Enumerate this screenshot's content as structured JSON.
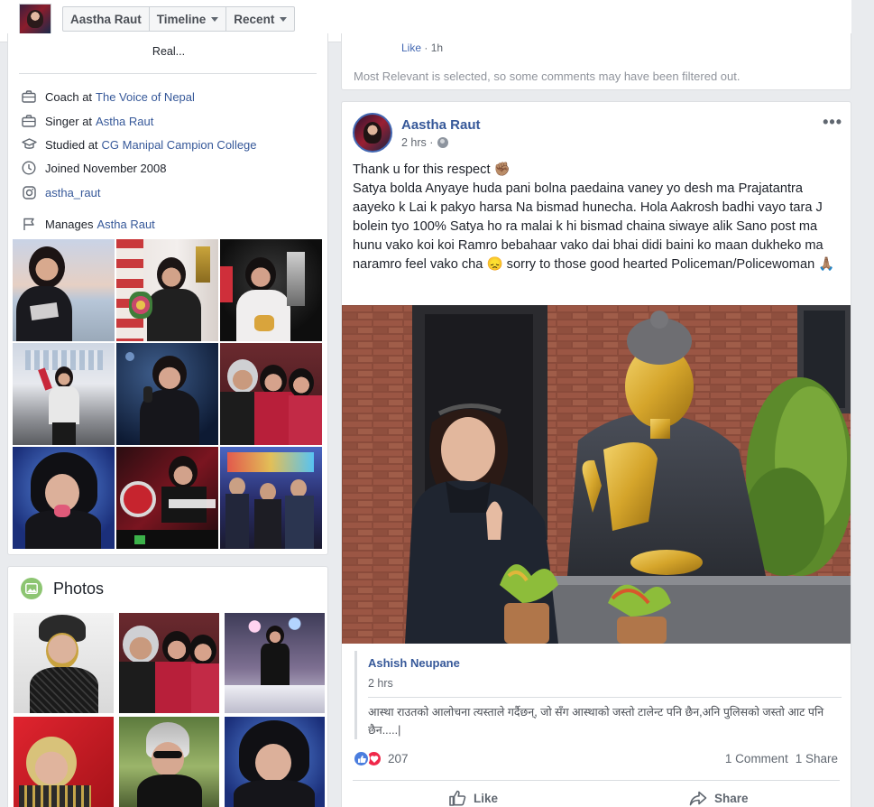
{
  "topbar": {
    "nav": [
      {
        "label": "Aastha Raut",
        "caret": false
      },
      {
        "label": "Timeline",
        "caret": true
      },
      {
        "label": "Recent",
        "caret": true
      }
    ]
  },
  "intro": {
    "bio_tail": "Real...",
    "rows": [
      {
        "icon": "briefcase-icon",
        "prefix": "Coach at",
        "link": "The Voice of Nepal"
      },
      {
        "icon": "briefcase-icon",
        "prefix": "Singer at",
        "link": "Astha Raut"
      },
      {
        "icon": "graduation-cap-icon",
        "prefix": "Studied at",
        "link": "CG Manipal Campion College"
      },
      {
        "icon": "clock-icon",
        "prefix": "Joined November 2008",
        "link": ""
      },
      {
        "icon": "instagram-icon",
        "prefix": "",
        "link": "astha_raut"
      },
      {
        "icon": "flag-icon",
        "prefix": "Manages",
        "link": "Astha Raut"
      }
    ]
  },
  "photos": {
    "title": "Photos"
  },
  "previous_post": {
    "like_label": "Like",
    "like_time": "1h",
    "filter_note": "Most Relevant is selected, so some comments may have been filtered out."
  },
  "post": {
    "author": "Aastha Raut",
    "time": "2 hrs",
    "more": "•••",
    "text_lines": [
      "Thank u for this respect ✊🏽",
      "Satya bolda Anyaye huda pani bolna paedaina vaney yo desh ma Prajatantra aayeko k Lai k pakyo harsa Na bismad hunecha. Hola Aakrosh badhi vayo tara J bolein tyo 100% Satya ho ra malai k hi bismad chaina siwaye alik Sano post ma hunu vako koi koi Ramro bebahaar vako dai bhai didi baini ko maan dukheko ma naramro feel vako cha 😞 sorry to those good hearted Policeman/Policewoman 🙏🏽"
    ],
    "shared": {
      "author": "Ashish Neupane",
      "time": "2 hrs",
      "text": "आस्था राउतको आलोचना त्यस्ताले गर्दैछन्, जो सँग आस्थाको जस्तो टालेन्ट पनि छैन,अनि पुलिसको जस्तो आट पनि छैन.....|"
    },
    "reactions_count": "207",
    "comments_label": "1 Comment",
    "shares_label": "1 Share",
    "like_action": "Like",
    "share_action": "Share"
  },
  "colors": {
    "link": "#365899",
    "accent": "#4267b2",
    "background": "#e9ebee"
  }
}
